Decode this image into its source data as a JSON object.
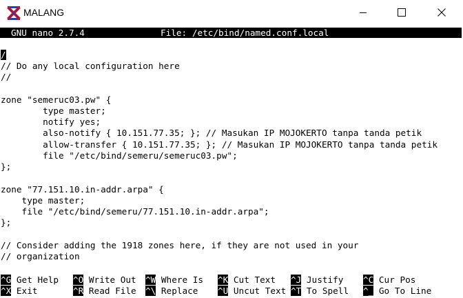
{
  "window": {
    "title": "MALANG",
    "icon": "putty-x-icon",
    "controls": [
      "minimize-icon",
      "maximize-icon",
      "close-icon"
    ]
  },
  "nano": {
    "version": "GNU nano 2.7.4",
    "file": "File: /etc/bind/named.conf.local"
  },
  "editor": {
    "cursor_char": "/",
    "lines": [
      "/",
      "// Do any local configuration here",
      "//",
      "",
      "zone \"semeruc03.pw\" {",
      "        type master;",
      "        notify yes;",
      "        also-notify { 10.151.77.35; }; // Masukan IP MOJOKERTO tanpa tanda petik",
      "        allow-transfer { 10.151.77.35; }; // Masukan IP MOJOKERTO tanpa tanda petik",
      "        file \"/etc/bind/semeru/semeruc03.pw\";",
      "};",
      "",
      "zone \"77.151.10.in-addr.arpa\" {",
      "    type master;",
      "    file \"/etc/bind/semeru/77.151.10.in-addr.arpa\";",
      "};",
      "",
      "// Consider adding the 1918 zones here, if they are not used in your",
      "// organization"
    ]
  },
  "shortcuts": {
    "row1": [
      {
        "key": "^G",
        "label": "Get Help"
      },
      {
        "key": "^O",
        "label": "Write Out"
      },
      {
        "key": "^W",
        "label": "Where Is"
      },
      {
        "key": "^K",
        "label": "Cut Text"
      },
      {
        "key": "^J",
        "label": "Justify"
      },
      {
        "key": "^C",
        "label": "Cur Pos"
      }
    ],
    "row2": [
      {
        "key": "^X",
        "label": "Exit"
      },
      {
        "key": "^R",
        "label": "Read File"
      },
      {
        "key": "^\\",
        "label": "Replace"
      },
      {
        "key": "^U",
        "label": "Uncut Text"
      },
      {
        "key": "^T",
        "label": "To Spell"
      },
      {
        "key": "^_",
        "label": "Go To Line"
      }
    ]
  },
  "colors": {
    "terminal_bg": "#ffffff",
    "terminal_fg": "#000000",
    "inverse_bg": "#000000",
    "inverse_fg": "#ffffff",
    "icon_blue": "#1f3fbf",
    "icon_red": "#d01010"
  }
}
